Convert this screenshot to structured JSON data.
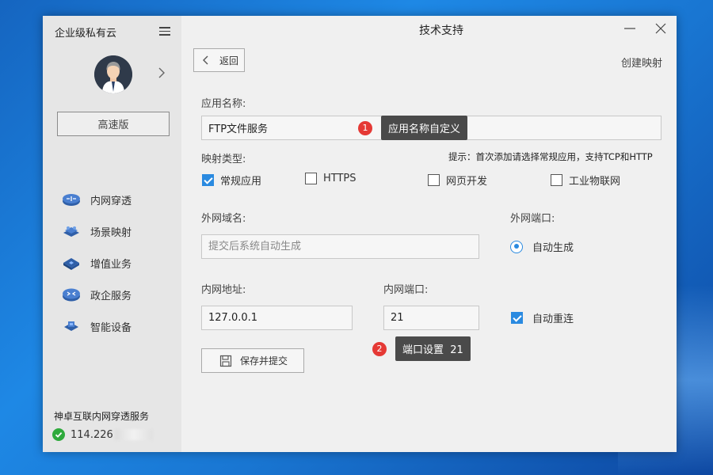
{
  "app": {
    "title": "企业级私有云"
  },
  "sidebar": {
    "plan_label": "高速版",
    "items": [
      {
        "label": "内网穿透",
        "icon": "network-icon"
      },
      {
        "label": "场景映射",
        "icon": "scene-mapping-icon"
      },
      {
        "label": "增值业务",
        "icon": "value-added-icon"
      },
      {
        "label": "政企服务",
        "icon": "enterprise-icon"
      },
      {
        "label": "智能设备",
        "icon": "smart-device-icon"
      }
    ],
    "service_name": "神卓互联内网穿透服务",
    "ip_prefix": "114.226"
  },
  "titlebar": {
    "support_label": "技术支持"
  },
  "toolbar": {
    "back_label": "返回",
    "create_label": "创建映射"
  },
  "form": {
    "app_name_label": "应用名称:",
    "app_name_value": "FTP文件服务",
    "mapping_type_label": "映射类型:",
    "hint": "提示：首次添加请选择常规应用，支持TCP和HTTP",
    "types": [
      {
        "label": "常规应用",
        "checked": true
      },
      {
        "label": "HTTPS",
        "checked": false
      },
      {
        "label": "网页开发",
        "checked": false
      },
      {
        "label": "工业物联网",
        "checked": false
      }
    ],
    "domain_label": "外网域名:",
    "domain_placeholder": "提交后系统自动生成",
    "external_port_label": "外网端口:",
    "external_port_option": "自动生成",
    "internal_addr_label": "内网地址:",
    "internal_addr_value": "127.0.0.1",
    "internal_port_label": "内网端口:",
    "internal_port_value": "21",
    "auto_reconnect_label": "自动重连",
    "save_label": "保存并提交"
  },
  "tips": [
    {
      "num": "1",
      "text": "应用名称自定义"
    },
    {
      "num": "2",
      "text": "端口设置  21"
    }
  ],
  "colors": {
    "accent": "#2a8ae0",
    "badge": "#e53935",
    "tooltip": "#4a4a4a"
  }
}
